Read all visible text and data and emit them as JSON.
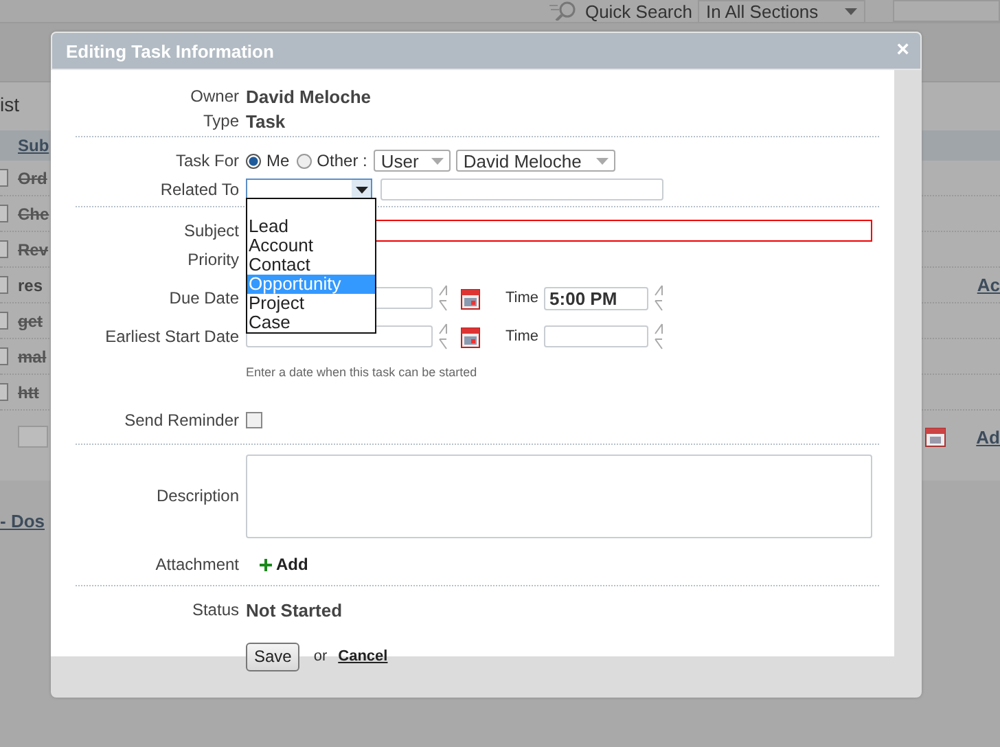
{
  "background": {
    "quick_search": "Quick Search",
    "search_scope": "In All Sections",
    "list_label": "ist",
    "column_header": "Sub",
    "rows": [
      {
        "text": "Ord",
        "done": true,
        "checked": false
      },
      {
        "text": "Che",
        "done": true,
        "checked": false
      },
      {
        "text": "Rev",
        "done": true,
        "checked": false
      },
      {
        "text": "res",
        "done": false,
        "checked": false,
        "link": "Ac"
      },
      {
        "text": "get",
        "done": true,
        "checked": false
      },
      {
        "text": "mal",
        "done": true,
        "checked": false
      },
      {
        "text": "htt",
        "done": true,
        "checked": false
      }
    ],
    "add_link": "Ad",
    "footer_link": "- Dos"
  },
  "dialog": {
    "title": "Editing Task Information",
    "close": "×",
    "owner": {
      "label": "Owner",
      "value": "David Meloche"
    },
    "type": {
      "label": "Type",
      "value": "Task"
    },
    "task_for": {
      "label": "Task For",
      "options": [
        {
          "label": "Me",
          "selected": true
        },
        {
          "label": "Other :",
          "selected": false
        }
      ],
      "user_type": "User",
      "user": "David Meloche"
    },
    "related_to": {
      "label": "Related To",
      "expanded": true,
      "options": [
        {
          "label": "Lead",
          "selected": false
        },
        {
          "label": "Account",
          "selected": false
        },
        {
          "label": "Contact",
          "selected": false
        },
        {
          "label": "Opportunity",
          "selected": true
        },
        {
          "label": "Project",
          "selected": false
        },
        {
          "label": "Case",
          "selected": false
        }
      ]
    },
    "subject": {
      "label": "Subject",
      "invalid": true
    },
    "priority": {
      "label": "Priority"
    },
    "due_date": {
      "label": "Due Date",
      "time_label": "Time",
      "time": "5:00 PM"
    },
    "earliest_start": {
      "label": "Earliest Start Date",
      "time_label": "Time",
      "hint": "Enter a date when this task can be started"
    },
    "send_reminder": {
      "label": "Send Reminder",
      "checked": false
    },
    "description": {
      "label": "Description"
    },
    "attachment": {
      "label": "Attachment",
      "action": "Add"
    },
    "status": {
      "label": "Status",
      "value": "Not Started"
    },
    "save": "Save",
    "or": "or",
    "cancel": "Cancel"
  }
}
